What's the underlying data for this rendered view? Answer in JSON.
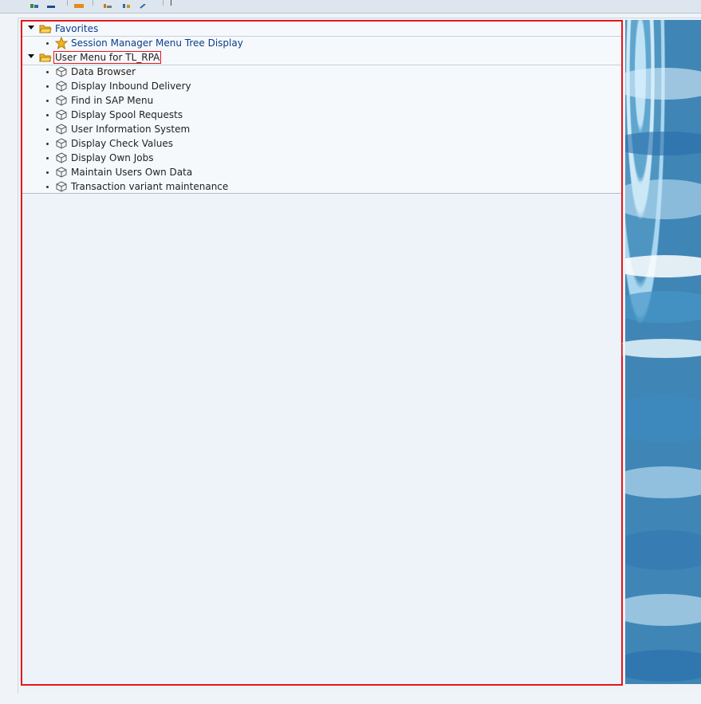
{
  "toolbar": {
    "icons": [
      "user-menu-icon",
      "sap-menu-icon",
      "add-favorite-icon",
      "change-favorite-icon",
      "move-favorite-icon",
      "more-icon"
    ]
  },
  "tree": {
    "favorites": {
      "label": "Favorites",
      "items": [
        {
          "label": "Session Manager Menu Tree Display",
          "icon": "star-icon"
        }
      ]
    },
    "user_menu": {
      "label": "User Menu for TL_RPA",
      "items": [
        {
          "label": "Data Browser",
          "icon": "cube-icon"
        },
        {
          "label": "Display Inbound Delivery",
          "icon": "cube-icon"
        },
        {
          "label": "Find in SAP Menu",
          "icon": "cube-icon"
        },
        {
          "label": "Display Spool Requests",
          "icon": "cube-icon"
        },
        {
          "label": "User Information System",
          "icon": "cube-icon"
        },
        {
          "label": "Display Check Values",
          "icon": "cube-icon"
        },
        {
          "label": "Display Own Jobs",
          "icon": "cube-icon"
        },
        {
          "label": "Maintain Users Own Data",
          "icon": "cube-icon"
        },
        {
          "label": "Transaction variant maintenance",
          "icon": "cube-icon"
        }
      ]
    }
  },
  "colors": {
    "highlight_border": "#e8141c",
    "link_text": "#0a3d8c",
    "folder_yellow": "#f2b51b"
  }
}
